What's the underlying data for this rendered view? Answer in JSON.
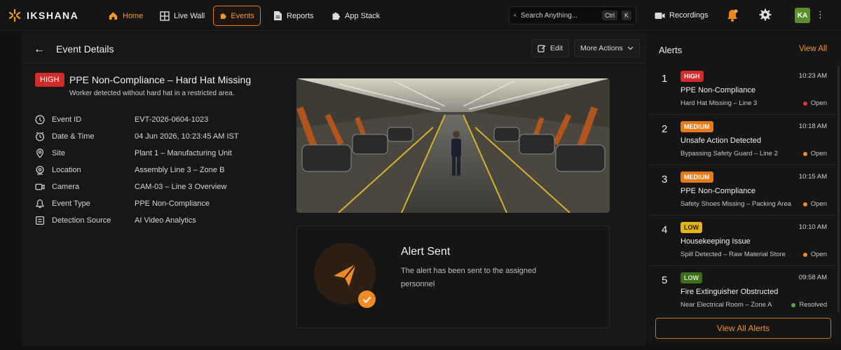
{
  "app": {
    "name": "IKSHANA"
  },
  "nav": {
    "items": [
      {
        "label": "Home",
        "icon": "home-icon"
      },
      {
        "label": "Live Wall",
        "icon": "grid-icon"
      },
      {
        "label": "Events",
        "icon": "puzzle-icon"
      },
      {
        "label": "Reports",
        "icon": "document-icon"
      },
      {
        "label": "App Stack",
        "icon": "puzzle-icon"
      }
    ],
    "active": "Events",
    "search": {
      "placeholder": "Search Anything...",
      "shortcut_ctrl": "Ctrl",
      "shortcut_key": "K"
    },
    "recordings_label": "Recordings",
    "user_initials": "KA",
    "accent_color": "#f59a2a",
    "avatar_color": "#5a8f2a"
  },
  "event": {
    "page_title": "Event Details",
    "edit_label": "Edit",
    "more_actions_label": "More Actions",
    "severity": "HIGH",
    "title": "PPE Non-Compliance – Hard Hat Missing",
    "description": "Worker detected without hard hat in a restricted area.",
    "details": [
      {
        "icon": "info-icon",
        "label": "Event ID",
        "value": "EVT-2026-0604-1023"
      },
      {
        "icon": "clock-icon",
        "label": "Date & Time",
        "value": "04 Jun 2026, 10:23:45 AM IST"
      },
      {
        "icon": "site-icon",
        "label": "Site",
        "value": "Plant 1 – Manufacturing Unit"
      },
      {
        "icon": "location-pin-icon",
        "label": "Location",
        "value": "Assembly Line 3 – Zone B"
      },
      {
        "icon": "camera-icon",
        "label": "Camera",
        "value": "CAM-03 – Line 3 Overview"
      },
      {
        "icon": "tag-icon",
        "label": "Event Type",
        "value": "PPE Non-Compliance"
      },
      {
        "icon": "source-icon",
        "label": "Detection Source",
        "value": "AI Video Analytics"
      }
    ],
    "alert_card": {
      "title": "Alert Sent",
      "text": "The alert has been sent to the assigned personnel"
    }
  },
  "alerts": {
    "title": "Alerts",
    "view_all_link": "View All",
    "view_all_button": "View All Alerts",
    "items": [
      {
        "num": "1",
        "severity": "HIGH",
        "time": "10:23 AM",
        "title": "PPE Non-Compliance",
        "subtitle": "Hard Hat Missing – Line 3",
        "status": "Open",
        "status_color": "#e03434"
      },
      {
        "num": "2",
        "severity": "MEDIUM",
        "time": "10:18 AM",
        "title": "Unsafe Action Detected",
        "subtitle": "Bypassing Safety Guard – Line 2",
        "status": "Open",
        "status_color": "#f08a24"
      },
      {
        "num": "3",
        "severity": "MEDIUM",
        "time": "10:15 AM",
        "title": "PPE Non-Compliance",
        "subtitle": "Safety Shoes Missing – Packing Area",
        "status": "Open",
        "status_color": "#f08a24"
      },
      {
        "num": "4",
        "severity": "LOW",
        "time": "10:10 AM",
        "title": "Housekeeping Issue",
        "subtitle": "Spill Detected – Raw Material Store",
        "status": "Open",
        "status_color": "#f08a24"
      },
      {
        "num": "5",
        "severity": "LOW",
        "time": "09:58 AM",
        "title": "Fire Extinguisher Obstructed",
        "subtitle": "Near Electrical Room – Zone A",
        "status": "Resolved",
        "status_color": "#4caf3a"
      }
    ]
  }
}
